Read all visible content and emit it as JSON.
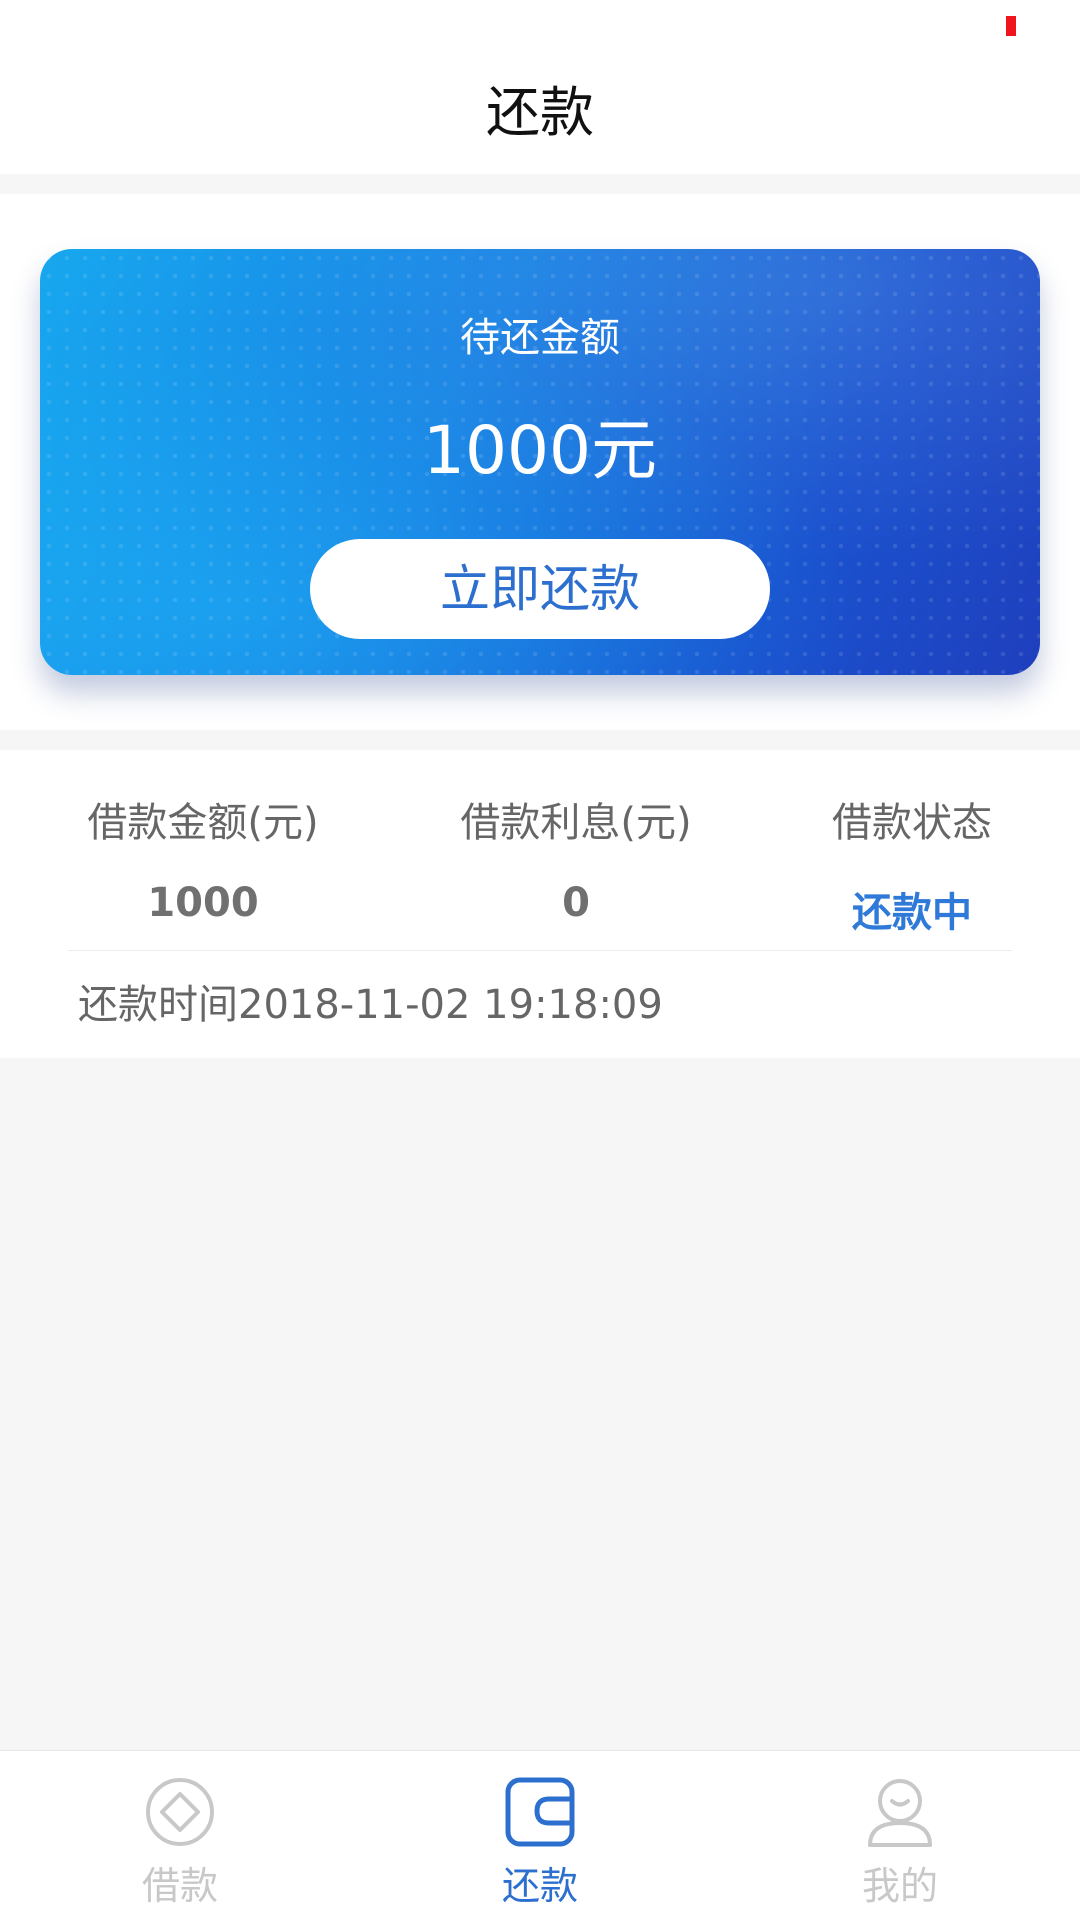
{
  "header": {
    "title": "还款"
  },
  "card": {
    "label": "待还金额",
    "amount": "1000元",
    "button_label": "立即还款"
  },
  "loan_info": {
    "headers": [
      "借款金额(元)",
      "借款利息(元)",
      "借款状态"
    ],
    "values": [
      "1000",
      "0",
      "还款中"
    ],
    "repay_time": "还款时间2018-11-02 19:18:09"
  },
  "tabs": [
    {
      "label": "借款",
      "icon": "loan-icon",
      "active": false
    },
    {
      "label": "还款",
      "icon": "repay-wallet-icon",
      "active": true
    },
    {
      "label": "我的",
      "icon": "profile-icon",
      "active": false
    }
  ],
  "colors": {
    "accent": "#2c6fcf",
    "status": "#2f7ad8",
    "inactive_tab": "#c8c8c8",
    "status_indicator": "#f0141e"
  }
}
